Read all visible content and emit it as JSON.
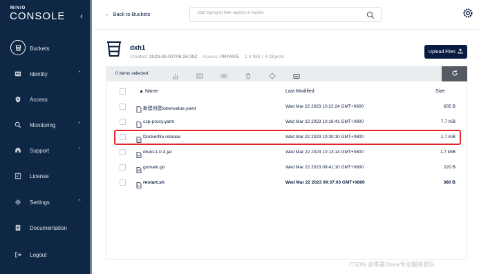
{
  "brand": {
    "top": "MINIO",
    "name": "CONSOLE"
  },
  "sidebar": {
    "items": [
      {
        "label": "Buckets",
        "icon": "bucket-icon",
        "chevron": false
      },
      {
        "label": "Identity",
        "icon": "identity-icon",
        "chevron": true
      },
      {
        "label": "Access",
        "icon": "lock-icon",
        "chevron": false
      },
      {
        "label": "Monitoring",
        "icon": "monitoring-icon",
        "chevron": true
      },
      {
        "label": "Support",
        "icon": "support-icon",
        "chevron": true
      },
      {
        "label": "License",
        "icon": "license-icon",
        "chevron": false
      },
      {
        "label": "Settings",
        "icon": "gear-icon",
        "chevron": true
      },
      {
        "label": "Documentation",
        "icon": "document-icon",
        "chevron": false
      },
      {
        "label": "Logout",
        "icon": "logout-icon",
        "chevron": false
      }
    ]
  },
  "header": {
    "back_label": "Back to Buckets",
    "search_placeholder": "Start typing to filter objects in bucket"
  },
  "bucket": {
    "name": "dxh1",
    "created_label": "Created:",
    "created": "2023-03-02T06:26:30Z",
    "access_label": "Access:",
    "access": "PRIVATE",
    "stats": "1.8 MiB / 4 Objects",
    "upload_label": "Upload Files"
  },
  "toolbar": {
    "selected": "0 Items selected"
  },
  "table": {
    "headers": {
      "name": "Name",
      "modified": "Last Modified",
      "size": "Size"
    },
    "rows": [
      {
        "name": "新建创建tokenvalue.yaml",
        "modified": "Wed Mar 22 2023 10:22:24 GMT+0800",
        "size": "605 B"
      },
      {
        "name": "csp-proxy.yaml",
        "modified": "Wed Mar 22 2023 10:16:41 GMT+0800",
        "size": "7.7 KiB"
      },
      {
        "name": "Dockerfile.release",
        "modified": "Wed Mar 22 2023 10:30:10 GMT+0800",
        "size": "1.7 KiB"
      },
      {
        "name": "druid-1.0.4.jar",
        "modified": "Wed Mar 22 2023 10:13:14 GMT+0800",
        "size": "1.7 MiB"
      },
      {
        "name": "gomain.go",
        "modified": "Wed Mar 22 2023 09:41:10 GMT+0800",
        "size": "220 B"
      },
      {
        "name": "restart.sh",
        "modified": "Wed Mar 22 2023 09:37:03 GMT+0800",
        "size": "380 B"
      }
    ]
  },
  "watermark": "CSDN @零基Stack专业服务团队",
  "colors": {
    "sidebar": "#0e2744",
    "accent": "#081c42",
    "highlight": "#e0262a"
  }
}
